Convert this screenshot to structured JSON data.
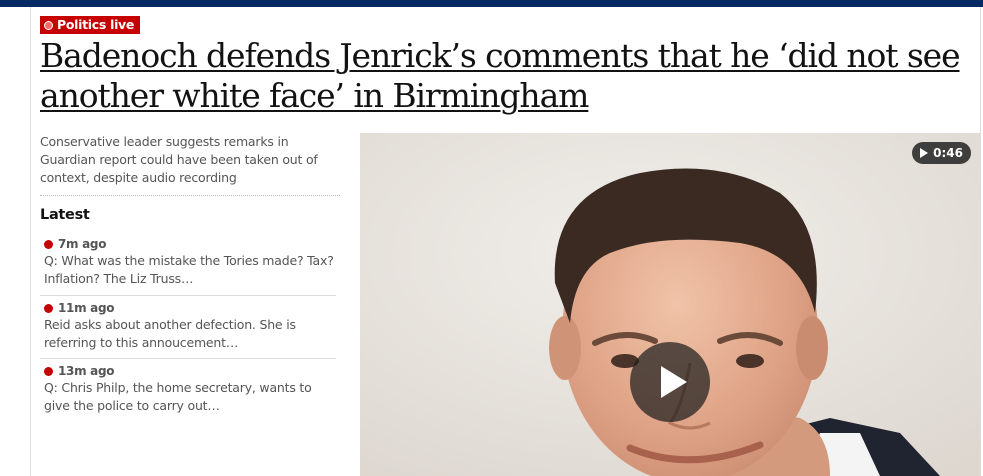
{
  "kicker": {
    "label": "Politics live"
  },
  "headline": "Badenoch defends Jenrick’s comments that he ‘did not see another white face’ in Birmingham",
  "standfirst": "Conservative leader suggests remarks in Guardian report could have been taken out of context, despite audio recording",
  "latest": {
    "title": "Latest",
    "items": [
      {
        "time": "7m ago",
        "text": "Q: What was the mistake the Tories made? Tax? Inflation? The Liz Truss…"
      },
      {
        "time": "11m ago",
        "text": "Reid asks about another defection. She is referring to this annoucement…"
      },
      {
        "time": "13m ago",
        "text": "Q: Chris Philp, the home secretary, wants to give the police to carry out…"
      }
    ]
  },
  "video": {
    "duration": "0:46",
    "icons": [
      "play-icon",
      "play-button-icon"
    ]
  },
  "colors": {
    "brand_bar": "#052962",
    "live_red": "#c70000",
    "text": "#121212",
    "muted": "#555555"
  }
}
